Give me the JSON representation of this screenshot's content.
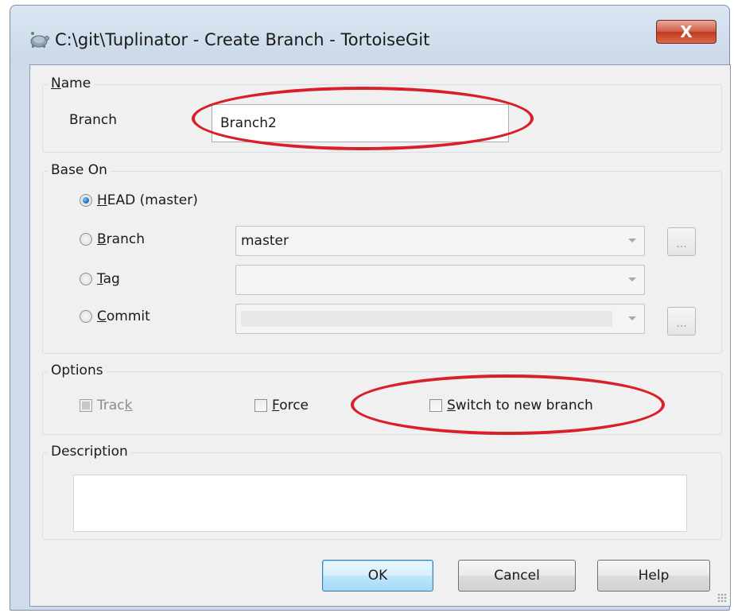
{
  "window": {
    "title": "C:\\git\\Tuplinator - Create Branch - TortoiseGit",
    "close_glyph": "X"
  },
  "name_group": {
    "legend_prefix": "",
    "legend_mnemonic": "N",
    "legend_rest": "ame",
    "branch_label": "Branch",
    "branch_value": "Branch2"
  },
  "base_on": {
    "legend": "Base On",
    "head": {
      "mnemonic": "H",
      "rest": "EAD (master)",
      "checked": true
    },
    "branch": {
      "mnemonic": "B",
      "rest": "ranch",
      "value": "master"
    },
    "tag": {
      "mnemonic": "T",
      "rest": "ag",
      "value": ""
    },
    "commit": {
      "mnemonic": "C",
      "rest": "ommit",
      "value": ""
    },
    "browse_label": "..."
  },
  "options": {
    "legend": "Options",
    "track": {
      "prefix": "Trac",
      "mnemonic": "k",
      "rest": ""
    },
    "force": {
      "prefix": "",
      "mnemonic": "F",
      "rest": "orce"
    },
    "switch": {
      "prefix": "",
      "mnemonic": "S",
      "rest": "witch to new branch"
    }
  },
  "description": {
    "legend": "Description",
    "value": ""
  },
  "buttons": {
    "ok": "OK",
    "cancel": "Cancel",
    "help": "Help"
  },
  "colors": {
    "annotation": "#d8202a",
    "close_button": "#c0391f",
    "default_button_border": "#3c7fb1"
  },
  "icons": {
    "app": "tortoisegit-icon",
    "close": "close-icon",
    "dropdown": "chevron-down-icon"
  }
}
